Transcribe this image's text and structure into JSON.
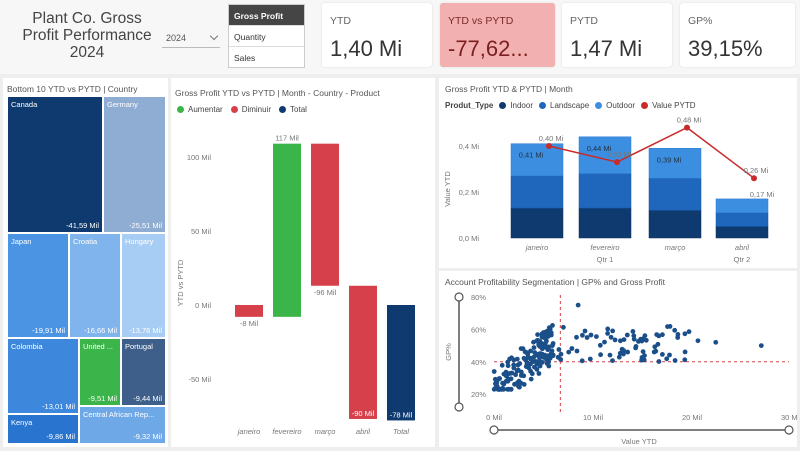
{
  "header": {
    "title_line1": "Plant Co. Gross",
    "title_line2": "Profit Performance",
    "title_line3": "2024",
    "year_value": "2024"
  },
  "slicer": [
    "Gross Profit",
    "Quantity",
    "Sales"
  ],
  "cards": [
    {
      "label": "YTD",
      "value": "1,40 Mi"
    },
    {
      "label": "YTD vs PYTD",
      "value": "-77,62..."
    },
    {
      "label": "PYTD",
      "value": "1,47 Mi"
    },
    {
      "label": "GP%",
      "value": "39,15%"
    }
  ],
  "colors": {
    "dark_blue": "#0f3a6f",
    "mid_blue": "#1f67bc",
    "light_blue": "#3c8ee0",
    "red": "#d6404a",
    "green": "#3bb54a",
    "alert_card": "#f3b0b0"
  },
  "treemap": {
    "title": "Bottom 10 YTD vs PYTD | Country",
    "cells": [
      {
        "name": "Canada",
        "value": "-41,59 Mil"
      },
      {
        "name": "Germany",
        "value": "-25,51 Mil"
      },
      {
        "name": "Japan",
        "value": "-19,91 Mil"
      },
      {
        "name": "Croatia",
        "value": "-16,66 Mil"
      },
      {
        "name": "Hungary",
        "value": "-13,76 Mil"
      },
      {
        "name": "Colombia",
        "value": "-13,01 Mil"
      },
      {
        "name": "United ...",
        "value": "-9,51 Mil"
      },
      {
        "name": "Portugal",
        "value": "-9,44 Mil"
      },
      {
        "name": "Kenya",
        "value": "-9,86 Mil"
      },
      {
        "name": "Central African Rep...",
        "value": "-9,32 Mil"
      }
    ]
  },
  "waterfall": {
    "title": "Gross Profit YTD vs PYTD | Month - Country - Product",
    "legend": [
      "Aumentar",
      "Diminuir",
      "Total"
    ],
    "ylabel": "YTD vs PYTD",
    "yticks": [
      "100 Mil",
      "50 Mil",
      "0 Mil",
      "-50 Mil"
    ],
    "bars": [
      {
        "month": "janeiro",
        "label": "-8 Mil"
      },
      {
        "month": "fevereiro",
        "label": "117 Mil"
      },
      {
        "month": "março",
        "label": "-96 Mil"
      },
      {
        "month": "abril",
        "label": "-90 Mil"
      },
      {
        "month": "Total",
        "label": "-78 Mil"
      }
    ]
  },
  "chart_data": [
    {
      "type": "bar",
      "title": "Gross Profit YTD vs PYTD | Month - Country - Product",
      "categories": [
        "janeiro",
        "fevereiro",
        "março",
        "abril",
        "Total"
      ],
      "values": [
        -8,
        117,
        -96,
        -90,
        -78
      ],
      "ylabel": "YTD vs PYTD",
      "ylim": [
        -75,
        110
      ]
    },
    {
      "type": "bar",
      "title": "Gross Profit YTD & PYTD | Month",
      "categories": [
        "janeiro",
        "fevereiro",
        "março",
        "abril"
      ],
      "series": [
        {
          "name": "Indoor",
          "values": [
            0.13,
            0.13,
            0.12,
            0.05
          ]
        },
        {
          "name": "Landscape",
          "values": [
            0.14,
            0.15,
            0.14,
            0.06
          ]
        },
        {
          "name": "Outdoor",
          "values": [
            0.14,
            0.16,
            0.13,
            0.06
          ]
        },
        {
          "name": "Value PYTD",
          "values": [
            0.4,
            0.33,
            0.48,
            0.26
          ]
        }
      ],
      "ylabel": "Value YTD",
      "ylim": [
        0,
        0.5
      ]
    },
    {
      "type": "scatter",
      "title": "Account Profitability Segmentation | GP% and Gross Profit",
      "xlabel": "Value YTD",
      "ylabel": "GP%",
      "xlim": [
        0,
        30
      ],
      "ylim": [
        20,
        80
      ]
    }
  ],
  "stacked": {
    "title": "Gross Profit YTD & PYTD | Month",
    "legend_title": "Produt_Type",
    "legend": [
      "Indoor",
      "Landscape",
      "Outdoor",
      "Value PYTD"
    ],
    "ylabel": "Value YTD",
    "yticks": [
      "0,4 Mi",
      "0,2 Mi",
      "0,0 Mi"
    ],
    "months": [
      "janeiro",
      "fevereiro",
      "março",
      "abril"
    ],
    "quarters": [
      "Qtr 1",
      "Qtr 2"
    ],
    "total_labels": [
      "0,41 Mi",
      "0,44 Mi",
      "0,39 Mi",
      "0,17 Mi"
    ],
    "pytd_labels": [
      "0,40 Mi",
      "0,33 Mi",
      "0,48 Mi",
      "0,26 Mi"
    ]
  },
  "scatter": {
    "title": "Account Profitability Segmentation | GP% and Gross Profit",
    "xlabel": "Value YTD",
    "ylabel": "GP%",
    "xticks": [
      "0 Mil",
      "10 Mil",
      "20 Mil",
      "30 Mil"
    ],
    "yticks": [
      "80%",
      "60%",
      "40%",
      "20%"
    ]
  }
}
